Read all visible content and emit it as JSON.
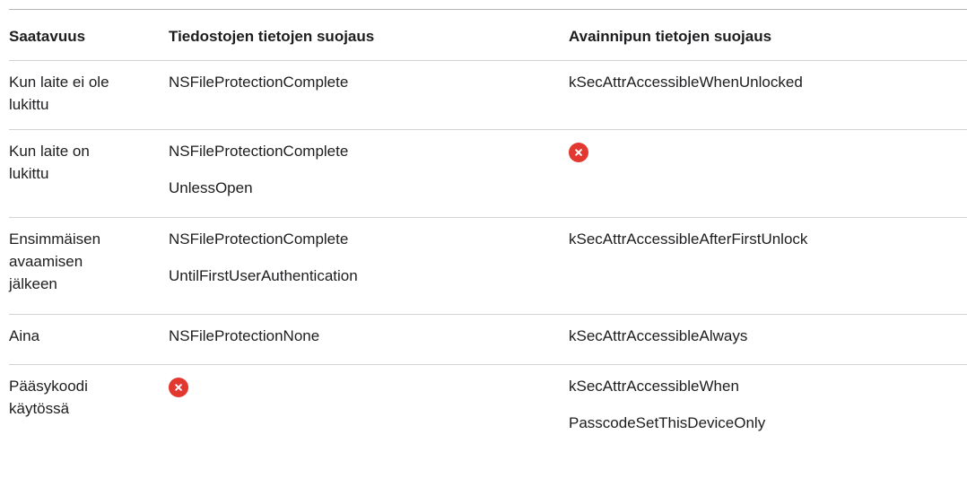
{
  "header": {
    "col1": "Saatavuus",
    "col2": "Tiedostojen tietojen suojaus",
    "col3": "Avainnipun tietojen suojaus"
  },
  "rows": [
    {
      "availability_lines": [
        "Kun laite ei ole",
        "lukittu"
      ],
      "file_lines": [
        "NSFileProtectionComplete"
      ],
      "keychain_lines": [
        "kSecAttrAccessibleWhenUnlocked"
      ],
      "file_unsupported": false,
      "keychain_unsupported": false
    },
    {
      "availability_lines": [
        "Kun laite on",
        "lukittu"
      ],
      "file_lines": [
        "NSFileProtectionComplete",
        "UnlessOpen"
      ],
      "keychain_lines": [],
      "file_unsupported": false,
      "keychain_unsupported": true,
      "keychain_icon": "x-circle-icon"
    },
    {
      "availability_lines": [
        "Ensimmäisen",
        "avaamisen",
        "jälkeen"
      ],
      "file_lines": [
        "NSFileProtectionComplete",
        "UntilFirstUserAuthentication"
      ],
      "keychain_lines": [
        "kSecAttrAccessibleAfterFirstUnlock"
      ],
      "file_unsupported": false,
      "keychain_unsupported": false
    },
    {
      "availability_lines": [
        "Aina"
      ],
      "file_lines": [
        "NSFileProtectionNone"
      ],
      "keychain_lines": [
        "kSecAttrAccessibleAlways"
      ],
      "file_unsupported": false,
      "keychain_unsupported": false
    },
    {
      "availability_lines": [
        "Pääsykoodi",
        "käytössä"
      ],
      "file_lines": [],
      "keychain_lines": [
        "kSecAttrAccessibleWhen",
        "PasscodeSetThisDeviceOnly"
      ],
      "file_unsupported": true,
      "file_icon": "x-circle-icon",
      "keychain_unsupported": false
    }
  ],
  "colors": {
    "text": "#1d1d1f",
    "divider": "#d2d2d7",
    "unsupported_icon": "#e3382f"
  }
}
